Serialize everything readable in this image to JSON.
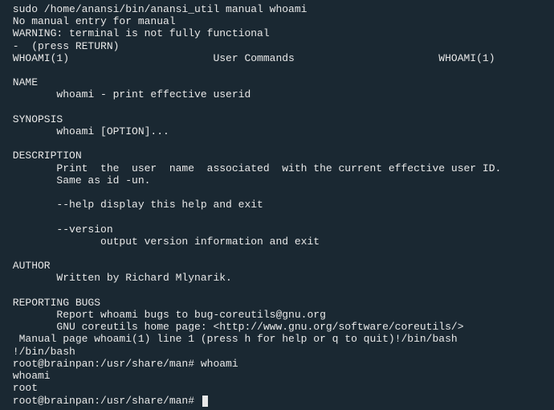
{
  "lines": {
    "l0": " sudo /home/anansi/bin/anansi_util manual whoami",
    "l1": " No manual entry for manual",
    "l2": " WARNING: terminal is not fully functional",
    "l3": " -  (press RETURN)",
    "l4": " WHOAMI(1)                       User Commands                       WHOAMI(1)",
    "l5": " ",
    "l6": " NAME",
    "l7": "        whoami - print effective userid",
    "l8": " ",
    "l9": " SYNOPSIS",
    "l10": "        whoami [OPTION]...",
    "l11": " ",
    "l12": " DESCRIPTION",
    "l13": "        Print  the  user  name  associated  with the current effective user ID.",
    "l14": "        Same as id -un.",
    "l15": " ",
    "l16": "        --help display this help and exit",
    "l17": " ",
    "l18": "        --version",
    "l19": "               output version information and exit",
    "l20": " ",
    "l21": " AUTHOR",
    "l22": "        Written by Richard Mlynarik.",
    "l23": " ",
    "l24": " REPORTING BUGS",
    "l25": "        Report whoami bugs to bug-coreutils@gnu.org",
    "l26": "        GNU coreutils home page: <http://www.gnu.org/software/coreutils/>",
    "l27": "  Manual page whoami(1) line 1 (press h for help or q to quit)!/bin/bash",
    "l28": " !/bin/bash",
    "l29": " root@brainpan:/usr/share/man# whoami",
    "l30": " whoami",
    "l31": " root",
    "l32": " root@brainpan:/usr/share/man# "
  }
}
